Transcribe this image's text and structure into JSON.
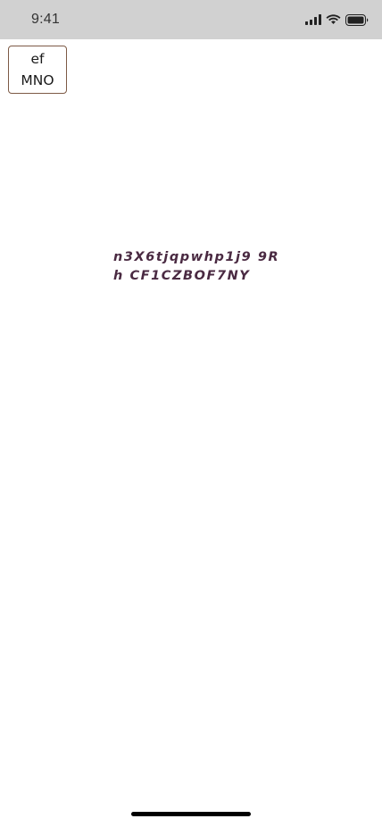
{
  "status_bar": {
    "time": "9:41",
    "icons": [
      "cellular-signal-icon",
      "wifi-icon",
      "battery-icon"
    ]
  },
  "top_button": {
    "line1": "ef",
    "line2": "MNO",
    "border_color": "#7d5a46"
  },
  "main": {
    "text_line1": "n3X6tjqpwhp1j9 9R",
    "text_line2": "h CF1CZBOF7NY",
    "text_color": "#4a2a42"
  }
}
